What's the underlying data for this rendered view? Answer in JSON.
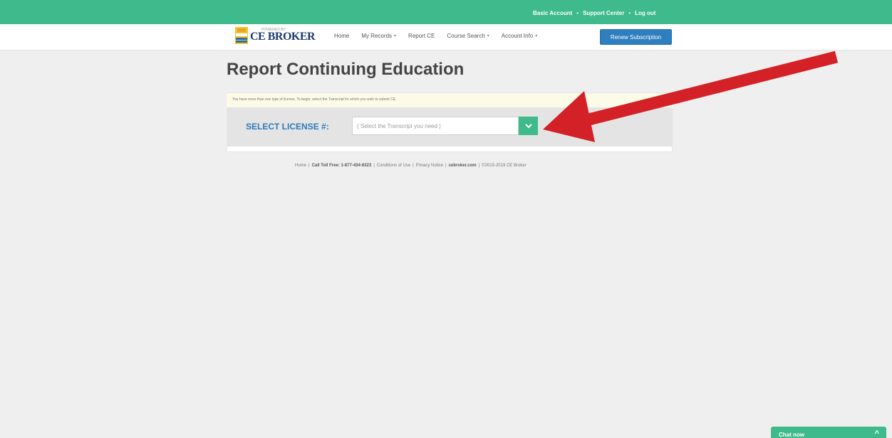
{
  "topbar": {
    "links": [
      "Basic Account",
      "Support Center",
      "Log out"
    ],
    "separator": "•"
  },
  "logo": {
    "brand": "CE BROKER",
    "tagline": "POWERED BY"
  },
  "nav": {
    "items": [
      {
        "label": "Home",
        "dropdown": false
      },
      {
        "label": "My Records",
        "dropdown": true
      },
      {
        "label": "Report CE",
        "dropdown": false
      },
      {
        "label": "Course Search",
        "dropdown": true
      },
      {
        "label": "Account Info",
        "dropdown": true
      }
    ],
    "caret": "▾",
    "renew_label": "Renew Subscription"
  },
  "main": {
    "title": "Report Continuing Education",
    "notice": "You have more than one type of license. To begin, select the Transcript for which you wish to submit CE.",
    "select_label": "SELECT LICENSE #:",
    "select_value": "( Select the Transcript you need )",
    "select_icon": "chevron-down-icon"
  },
  "footer": {
    "items": [
      "Home",
      "Call Toll Free: 1-877-434-6323",
      "Conditions of Use",
      "Privacy Notice",
      "cebroker.com",
      "©2015-2019 CE Broker"
    ]
  },
  "chat": {
    "label": "Chat now",
    "caret": "^"
  },
  "colors": {
    "accent": "#3fba8c",
    "button_blue": "#2e7fbf",
    "label_blue": "#2f7ab8",
    "arrow_red": "#d42027"
  }
}
